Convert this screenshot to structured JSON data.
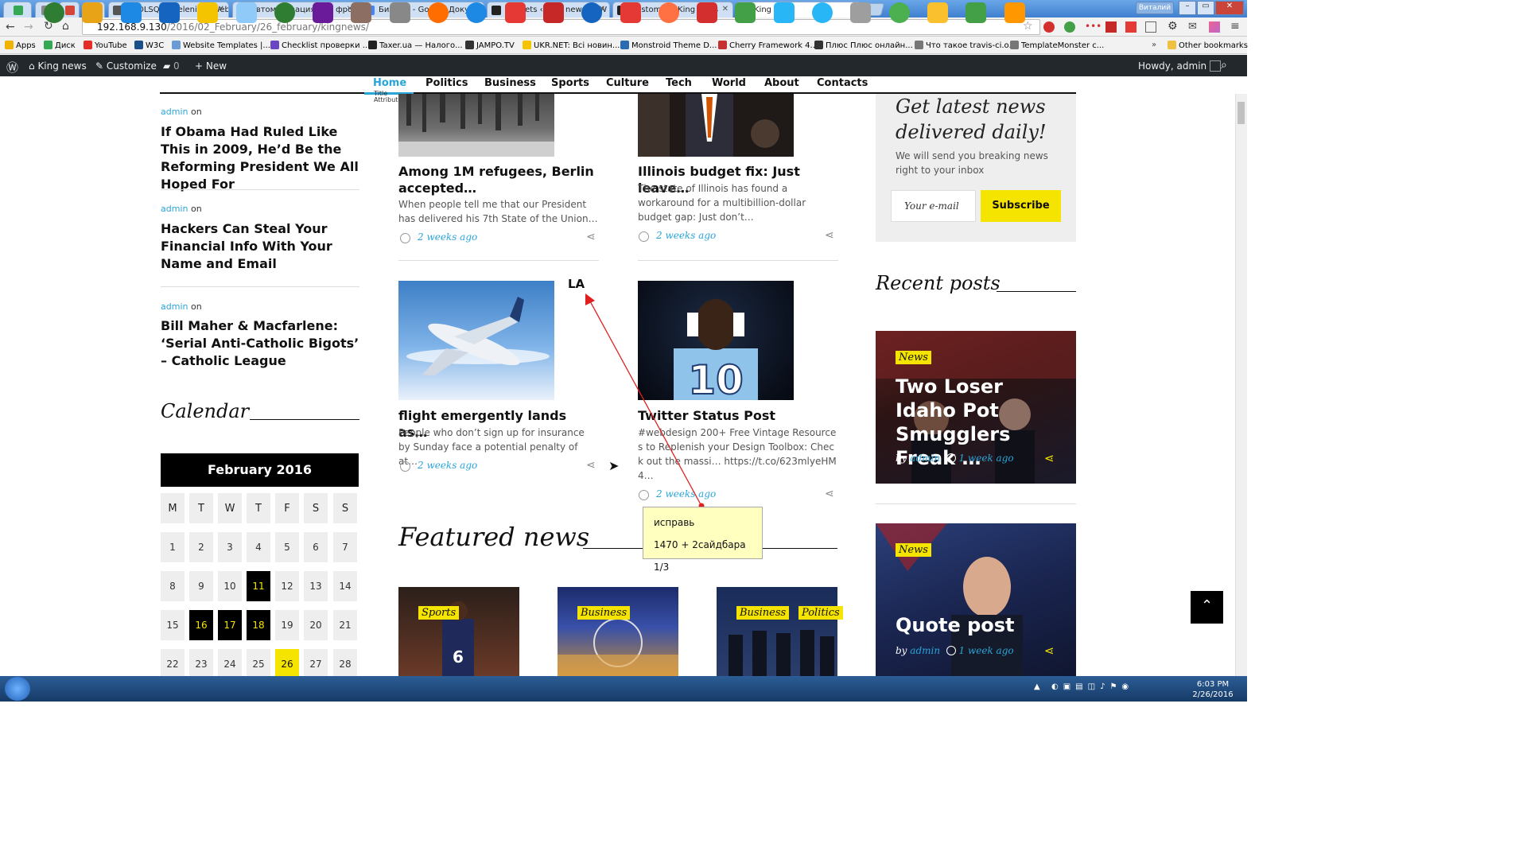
{
  "browser": {
    "tabs": [
      {
        "label": "",
        "color": "#34a853"
      },
      {
        "label": "",
        "color": "#888888"
      },
      {
        "label": "",
        "color": "#d44638"
      },
      {
        "label": "",
        "color": "#2b6cb0"
      },
      {
        "label": "TOOLSQA | Selenium Web",
        "color": "#555555"
      },
      {
        "label": "Автоматизация для фрон",
        "color": "#e52d27"
      },
      {
        "label": "Билеты - Google Докумен",
        "color": "#4285f4"
      },
      {
        "label": "Widgets ‹ King news — W",
        "color": "#222222"
      },
      {
        "label": "Customize: King news",
        "color": "#222222"
      },
      {
        "label": "King news",
        "color": "#222222"
      }
    ],
    "user": "Виталий",
    "url_host": "192.168.9.130",
    "url_path": "/2016/02_February/26_february/kingnews/",
    "bookmarks": [
      {
        "label": "Apps",
        "color": "#f0b400"
      },
      {
        "label": "Диск",
        "color": "#34a853"
      },
      {
        "label": "YouTube",
        "color": "#e52d27"
      },
      {
        "label": "W3C",
        "color": "#1a4f8a"
      },
      {
        "label": "Website Templates |...",
        "color": "#6a9bd4"
      },
      {
        "label": "Checklist проверки ...",
        "color": "#6b46c1"
      },
      {
        "label": "Taxer.ua — Налого...",
        "color": "#222222"
      },
      {
        "label": "JAMPO.TV",
        "color": "#333333"
      },
      {
        "label": "UKR.NET: Всі новин...",
        "color": "#f5c400"
      },
      {
        "label": "Monstroid Theme D...",
        "color": "#2b6cb0"
      },
      {
        "label": "Cherry Framework 4...",
        "color": "#c53030"
      },
      {
        "label": "Плюс Плюс онлайн...",
        "color": "#333333"
      },
      {
        "label": "Что такое travis-ci.o...",
        "color": "#777777"
      },
      {
        "label": "TemplateMonster c...",
        "color": "#777777"
      }
    ],
    "other_bookmarks": "Other bookmarks"
  },
  "adminbar": {
    "site": "King news",
    "customize": "Customize",
    "comments": "0",
    "new": "New",
    "howdy": "Howdy, admin"
  },
  "nav": {
    "items": [
      "Home",
      "Politics",
      "Business",
      "Sports",
      "Culture",
      "Tech",
      "World",
      "About",
      "Contacts"
    ],
    "title_attr_line1": "Title",
    "title_attr_line2": "Attribute"
  },
  "left_posts": [
    {
      "author": "admin",
      "on": "on",
      "title": "If Obama Had Ruled Like This in 2009, He’d Be the Reforming President We All Hoped For"
    },
    {
      "author": "admin",
      "on": "on",
      "title": "Hackers Can Steal Your Financial Info With Your Name and Email"
    },
    {
      "author": "admin",
      "on": "on",
      "title": "Bill Maher & Macfarlene: ‘Serial Anti-Catholic Bigots’ – Catholic League"
    }
  ],
  "calendar": {
    "title": "Calendar",
    "month": "February 2016",
    "weekdays": [
      "M",
      "T",
      "W",
      "T",
      "F",
      "S",
      "S"
    ],
    "days": [
      "1",
      "2",
      "3",
      "4",
      "5",
      "6",
      "7",
      "8",
      "9",
      "10",
      "11",
      "12",
      "13",
      "14",
      "15",
      "16",
      "17",
      "18",
      "19",
      "20",
      "21",
      "22",
      "23",
      "24",
      "25",
      "26",
      "27",
      "28"
    ],
    "highlighted": [
      "11",
      "16",
      "17",
      "18"
    ],
    "today": "26"
  },
  "posts": [
    {
      "title": "Among 1M refugees, Berlin accepted…",
      "excerpt": "When people tell me that our President has delivered his 7th State of the Union…",
      "time": "2 weeks ago"
    },
    {
      "title": "Illinois budget fix: Just leave…",
      "excerpt": "The state of Illinois has found a workaround for a multibillion-dollar budget gap: Just don’t…",
      "time": "2 weeks ago"
    },
    {
      "title": "flight emergently lands as…",
      "excerpt": "People who don’t sign up for insurance by Sunday face a potential penalty of at…",
      "time": "2 weeks ago"
    },
    {
      "title": "Twitter Status Post",
      "excerpt": "#webdesign 200+ Free Vintage Resources to Replenish your Design Toolbox: Check out the massi… https://t.co/623mlyeHM4…",
      "time": "2 weeks ago"
    }
  ],
  "featured": {
    "title": "Featured news",
    "cards": [
      {
        "tags": [
          "Sports"
        ]
      },
      {
        "tags": [
          "Business"
        ]
      },
      {
        "tags": [
          "Business",
          "Politics"
        ]
      }
    ]
  },
  "newsletter": {
    "title": "Get latest news delivered daily!",
    "text": "We will send you breaking news right to your inbox",
    "placeholder": "Your e-mail",
    "button": "Subscribe"
  },
  "recent": {
    "title": "Recent posts",
    "cards": [
      {
        "tag": "News",
        "title": "Two Loser Idaho Pot Smugglers Freak …",
        "by": "by",
        "author": "admin",
        "time": "1 week ago"
      },
      {
        "tag": "News",
        "title": "Quote post",
        "by": "by",
        "author": "admin",
        "time": "1 week ago"
      }
    ]
  },
  "annotation": {
    "label": "LA",
    "note_line1": "исправь",
    "note_line2": "1470 + 2сайдбара 1/3"
  },
  "taskbar": {
    "time": "6:03 PM",
    "date": "2/26/2016",
    "apps": [
      "#2e7d32",
      "#e8a317",
      "#1e88e5",
      "#1565c0",
      "#f5c400",
      "#90caf9",
      "#2e7d32",
      "#6a1b9a",
      "#8d6e63",
      "#888888",
      "#ff6d00",
      "#1e88e5",
      "#e53935",
      "#c62828",
      "#1565c0",
      "#e53935",
      "#ff7043",
      "#d32f2f",
      "#43a047",
      "#29b6f6",
      "#29b6f6",
      "#9e9e9e",
      "#4caf50",
      "#fbc02d",
      "#43a047",
      "#ff9800"
    ]
  }
}
